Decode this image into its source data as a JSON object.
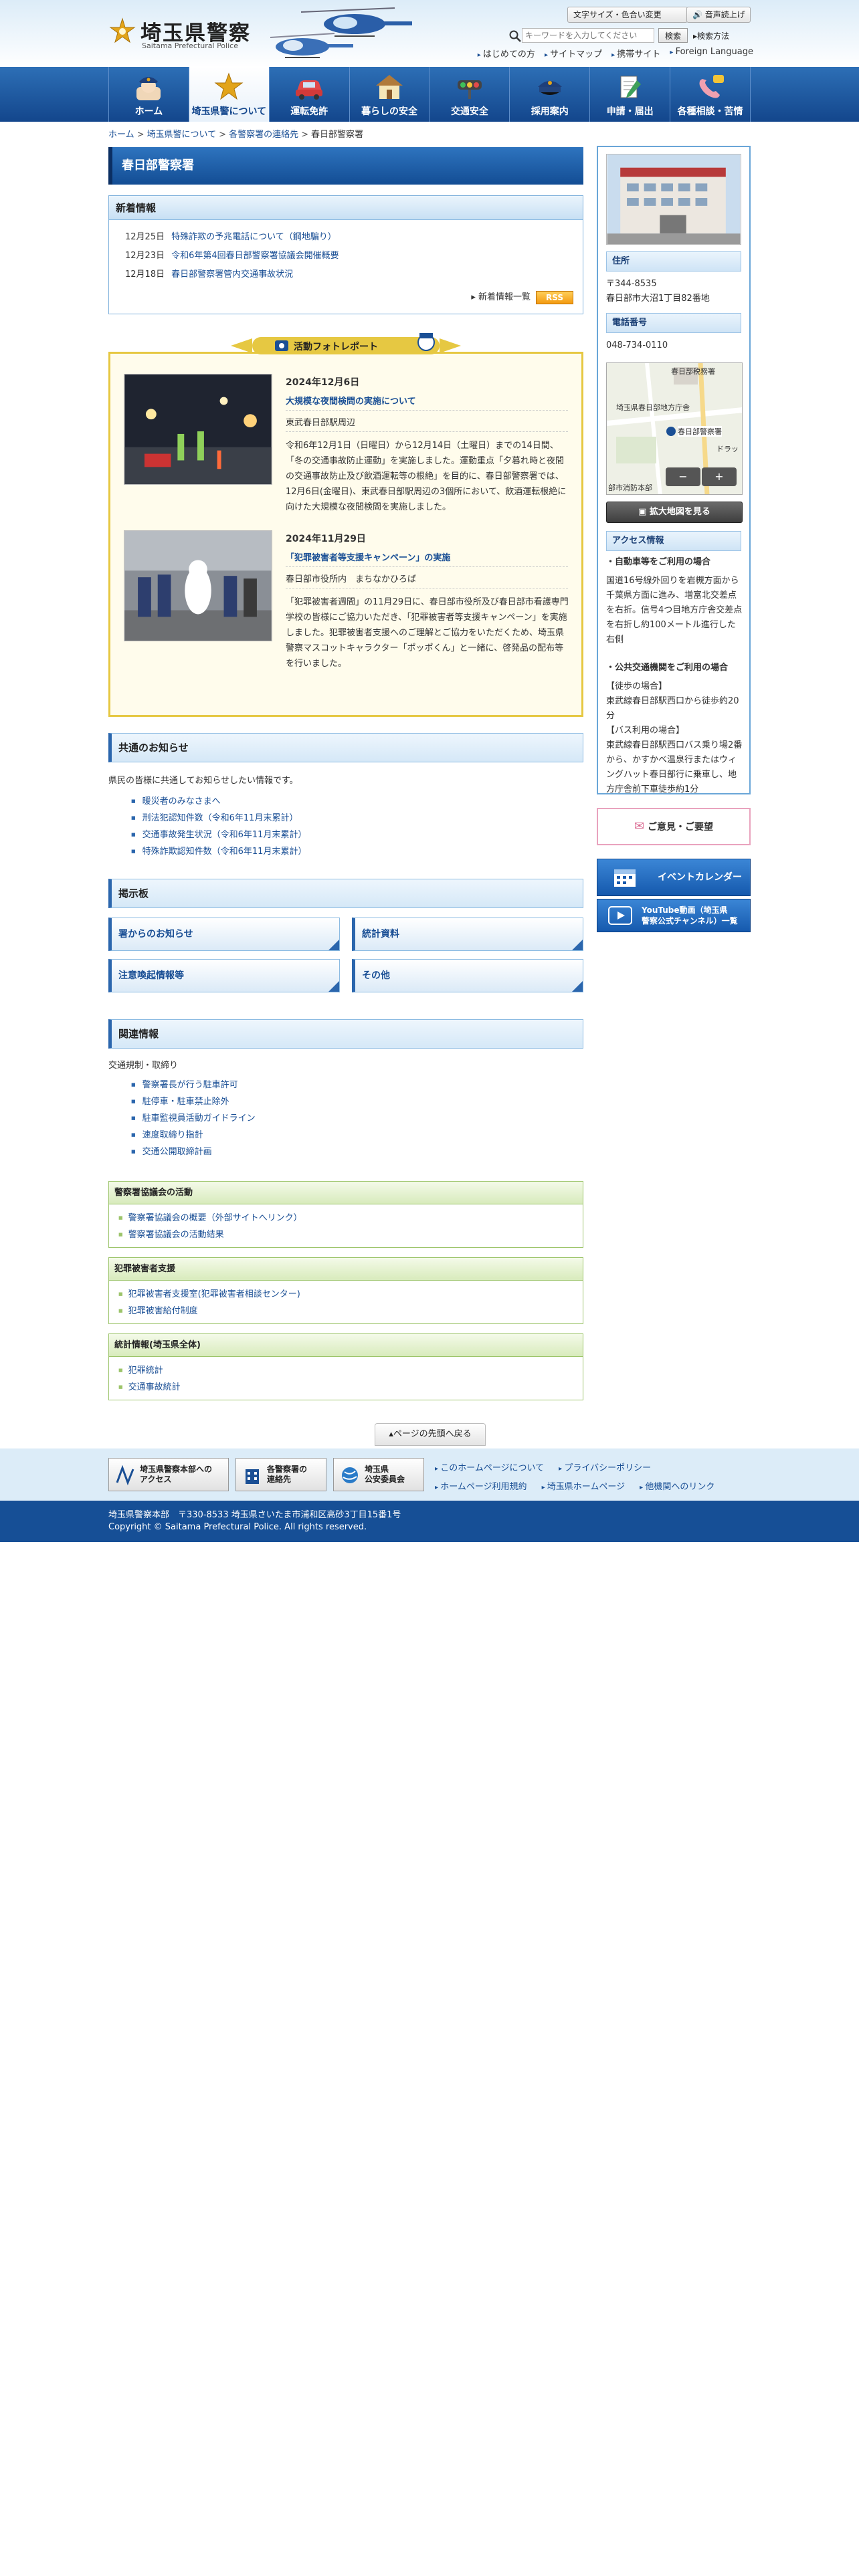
{
  "header": {
    "logo_title": "埼玉県警察",
    "logo_sub": "Saitama Prefectural Police",
    "font_color_button": "文字サイズ・色合い変更",
    "voice_button": "音声読上げ",
    "search_placeholder": "キーワードを入力してください",
    "search_button": "検索",
    "search_method": "検索方法",
    "util_links": [
      "はじめての方",
      "サイトマップ",
      "携帯サイト",
      "Foreign Language"
    ]
  },
  "nav": {
    "items": [
      {
        "label": "ホーム",
        "icon": "home-police-icon"
      },
      {
        "label": "埼玉県警について",
        "icon": "police-emblem-icon"
      },
      {
        "label": "運転免許",
        "icon": "car-icon"
      },
      {
        "label": "暮らしの安全",
        "icon": "house-icon"
      },
      {
        "label": "交通安全",
        "icon": "traffic-light-icon"
      },
      {
        "label": "採用案内",
        "icon": "police-cap-icon"
      },
      {
        "label": "申請・届出",
        "icon": "document-pen-icon"
      },
      {
        "label": "各種相談・苦情",
        "icon": "phone-icon"
      }
    ]
  },
  "breadcrumb": {
    "items": [
      "ホーム",
      "埼玉県警について",
      "各警察署の連絡先",
      "春日部警察署"
    ],
    "separator": ">"
  },
  "page": {
    "title": "春日部警察署"
  },
  "news": {
    "heading": "新着情報",
    "items": [
      {
        "date": "12月25日",
        "title": "特殊詐欺の予兆電話について（鋼地騙り）"
      },
      {
        "date": "12月23日",
        "title": "令和6年第4回春日部警察署協議会開催概要"
      },
      {
        "date": "12月18日",
        "title": "春日部警察署管内交通事故状況"
      }
    ],
    "more_label": "新着情報一覧",
    "rss_label": "RSS"
  },
  "photo_report": {
    "banner": "活動フォトレポート",
    "reports": [
      {
        "date": "2024年12月6日",
        "title": "大規模な夜間検問の実施について",
        "place": "東武春日部駅周辺",
        "body": "令和6年12月1日（日曜日）から12月14日（土曜日）までの14日間、「冬の交通事故防止運動」を実施しました。運動重点「夕暮れ時と夜間の交通事故防止及び飲酒運転等の根絶」を目的に、春日部警察署では、12月6日(金曜日)、東武春日部駅周辺の3個所において、飲酒運転根絶に向けた大規模な夜間検問を実施しました。"
      },
      {
        "date": "2024年11月29日",
        "title": "「犯罪被害者等支援キャンペーン」の実施",
        "place": "春日部市役所内　まちなかひろば",
        "body": "「犯罪被害者週間」の11月29日に、春日部市役所及び春日部市看護専門学校の皆様にご協力いただき、「犯罪被害者等支援キャンペーン」を実施しました。犯罪被害者支援へのご理解とご協力をいただくため、埼玉県警察マスコットキャラクター「ポッポくん」と一緒に、啓発品の配布等を行いました。"
      }
    ]
  },
  "common_notice": {
    "heading": "共通のお知らせ",
    "intro": "県民の皆様に共通してお知らせしたい情報です。",
    "links": [
      "暖災者のみなさまへ",
      "刑法犯認知件数（令和6年11月末累計）",
      "交通事故発生状況（令和6年11月末累計）",
      "特殊詐欺認知件数（令和6年11月末累計）"
    ]
  },
  "board": {
    "heading": "掲示板",
    "buttons": [
      "署からのお知らせ",
      "統計資料",
      "注意喚起情報等",
      "その他"
    ]
  },
  "related": {
    "heading": "関連情報",
    "subheading": "交通規制・取締り",
    "links": [
      "警察署長が行う駐車許可",
      "駐停車・駐車禁止除外",
      "駐車監視員活動ガイドライン",
      "速度取締り指針",
      "交通公開取締計画"
    ],
    "groups": [
      {
        "title": "警察署協議会の活動",
        "links": [
          "警察署協議会の概要（外部サイトへリンク）",
          "警察署協議会の活動結果"
        ]
      },
      {
        "title": "犯罪被害者支援",
        "links": [
          "犯罪被害者支援室(犯罪被害者相談センター)",
          "犯罪被害給付制度"
        ]
      },
      {
        "title": "統計情報(埼玉県全体)",
        "links": [
          "犯罪統計",
          "交通事故統計"
        ]
      }
    ]
  },
  "sidebar": {
    "address_heading": "住所",
    "address": "〒344-8535\n春日部市大沼1丁目82番地",
    "phone_heading": "電話番号",
    "phone": "048-734-0110",
    "map_labels": [
      "春日部税務署",
      "埼玉県春日部地方庁舎",
      "春日部警察署",
      "ドラッ",
      "部市消防本部"
    ],
    "map_button": "拡大地図を見る",
    "access_heading": "アクセス情報",
    "car_heading": "自動車等をご利用の場合",
    "car_text": "国道16号線外回りを岩槻方面から千葉県方面に進み、増富北交差点を右折。信号4つ目地方庁舎交差点を右折し約100メートル進行した右側",
    "transit_heading": "公共交通機関をご利用の場合",
    "transit_text": "【徒歩の場合】\n東武線春日部駅西口から徒歩約20分\n【バス利用の場合】\n東武線春日部駅西口バス乗り場2番から、かすかべ温泉行またはウィングハット春日部行に乗車し、地方庁舎前下車徒歩約1分",
    "opinion": "ご意見・ご要望",
    "event_calendar": "イベントカレンダー",
    "youtube_line1": "YouTube動画（埼玉県",
    "youtube_line2": "警察公式チャンネル）一覧"
  },
  "page_top": "ページの先頭へ戻る",
  "footer": {
    "buttons": [
      {
        "line1": "埼玉県警察本部への",
        "line2": "アクセス"
      },
      {
        "line1": "各警察署の",
        "line2": "連絡先"
      },
      {
        "line1": "埼玉県",
        "line2": "公安委員会"
      }
    ],
    "links_row1": [
      "このホームページについて",
      "プライバシーポリシー"
    ],
    "links_row2": [
      "ホームページ利用規約",
      "埼玉県ホームページ",
      "他機関へのリンク"
    ],
    "address": "埼玉県警察本部　〒330-8533 埼玉県さいたま市浦和区高砂3丁目15番1号",
    "copyright": "Copyright © Saitama Prefectural Police. All rights reserved."
  },
  "colors": {
    "nav_blue": "#13468c",
    "accent_gold": "#e6c842",
    "green_box": "#9cc46a"
  }
}
